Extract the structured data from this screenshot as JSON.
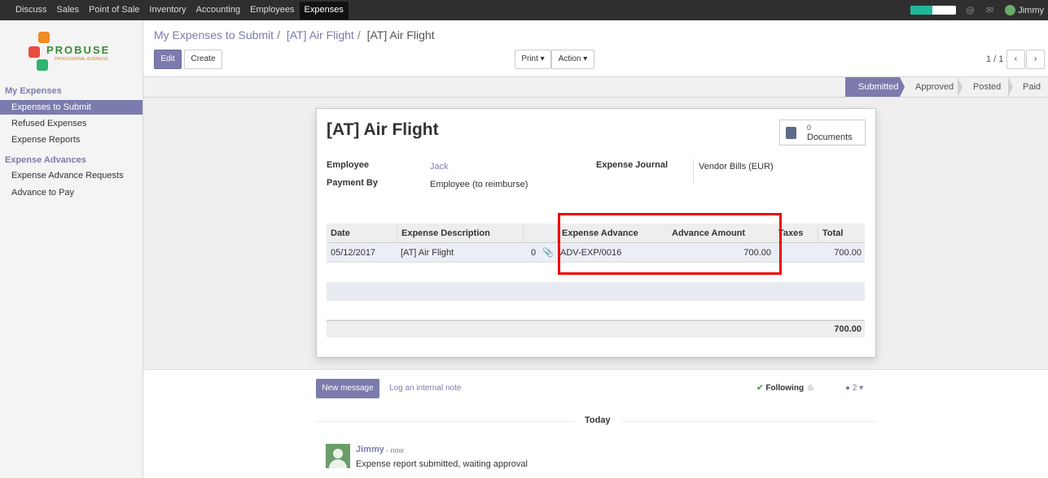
{
  "topbar": {
    "menu": [
      "Discuss",
      "Sales",
      "Point of Sale",
      "Inventory",
      "Accounting",
      "Employees",
      "Expenses"
    ],
    "active": "Expenses",
    "user": "Jimmy",
    "icons": [
      "switch-toggle",
      "at-icon",
      "chat-icon",
      "user-avatar"
    ]
  },
  "sidebar": {
    "logo": {
      "brand": "PROBUSE",
      "tagline": "PROFESSIONAL BUSINESS"
    },
    "section1": "My Expenses",
    "items1": [
      "Expenses to Submit",
      "Refused Expenses",
      "Expense Reports"
    ],
    "section2": "Expense Advances",
    "items2": [
      "Expense Advance Requests",
      "Advance to Pay"
    ]
  },
  "control_panel": {
    "breadcrumb": [
      "My Expenses to Submit",
      "[AT] Air Flight",
      "[AT] Air Flight"
    ],
    "edit": "Edit",
    "create": "Create",
    "print": "Print",
    "action": "Action",
    "pager": "1 / 1"
  },
  "status": {
    "stages": [
      "Submitted",
      "Approved",
      "Posted",
      "Paid"
    ],
    "active": "Submitted"
  },
  "form": {
    "title": "[AT] Air Flight",
    "documents_count": "0",
    "documents_label": "Documents",
    "employee_label": "Employee",
    "employee_value": "Jack",
    "payment_label": "Payment By",
    "payment_value": "Employee (to reimburse)",
    "journal_label": "Expense Journal",
    "journal_value": "Vendor Bills (EUR)"
  },
  "table": {
    "headers": [
      "Date",
      "Expense Description",
      "Expense Advance",
      "Advance Amount",
      "Taxes",
      "Total"
    ],
    "rows": [
      {
        "date": "05/12/2017",
        "desc": "[AT] Air Flight",
        "attachments": "0",
        "advance": "ADV-EXP/0016",
        "amount": "700.00",
        "taxes": "",
        "total": "700.00"
      }
    ],
    "footer_total": "700.00"
  },
  "chatter": {
    "new_message": "New message",
    "log_note": "Log an internal note",
    "following": "Following",
    "followers": "2",
    "today": "Today",
    "message": {
      "author": "Jimmy",
      "time": "- now",
      "body": "Expense report submitted, waiting approval"
    }
  },
  "colors": {
    "accent": "#7c7bad",
    "topbar": "#2f2f2f",
    "highlight": "#ee0000"
  }
}
